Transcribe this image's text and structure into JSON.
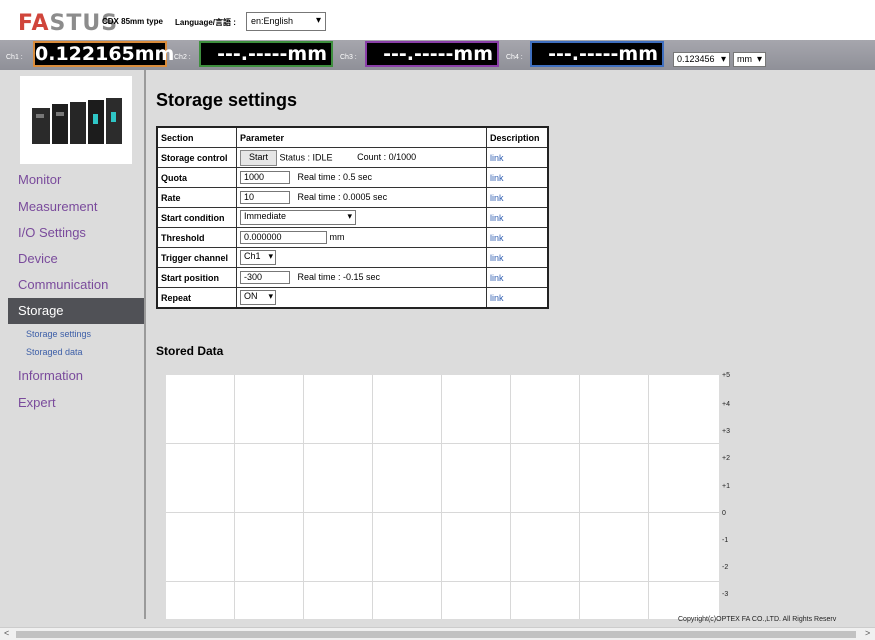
{
  "header": {
    "logo_fa": "FA",
    "logo_rest": "STUS",
    "product_type": "CDX 85mm type",
    "language_label": "Language/言語 :",
    "language_value": "en:English"
  },
  "channels": [
    {
      "label": "Ch1 :",
      "value": "0.122165mm",
      "border": "#d98c3c"
    },
    {
      "label": "Ch2 :",
      "value": "---.-----mm",
      "border": "#3e8f3e"
    },
    {
      "label": "Ch3 :",
      "value": "---.-----mm",
      "border": "#8a3fa8"
    },
    {
      "label": "Ch4 :",
      "value": "---.-----mm",
      "border": "#3f6fbf"
    }
  ],
  "display_format": "0.123456",
  "unit": "mm",
  "sidebar": {
    "items": [
      {
        "label": "Monitor"
      },
      {
        "label": "Measurement"
      },
      {
        "label": "I/O Settings"
      },
      {
        "label": "Device"
      },
      {
        "label": "Communication"
      },
      {
        "label": "Storage"
      },
      {
        "label": "Information"
      },
      {
        "label": "Expert"
      }
    ],
    "sub_items": [
      {
        "label": "Storage settings"
      },
      {
        "label": "Storaged data"
      }
    ]
  },
  "main": {
    "title": "Storage settings",
    "table": {
      "headers": [
        "Section",
        "Parameter",
        "Description"
      ],
      "storage_control": {
        "label": "Storage control",
        "button": "Start",
        "status": "Status : IDLE",
        "count": "Count : 0/1000",
        "link": "link"
      },
      "quota": {
        "label": "Quota",
        "value": "1000",
        "note": "Real time : 0.5 sec",
        "link": "link"
      },
      "rate": {
        "label": "Rate",
        "value": "10",
        "note": "Real time : 0.0005 sec",
        "link": "link"
      },
      "start_condition": {
        "label": "Start condition",
        "value": "Immediate",
        "link": "link"
      },
      "threshold": {
        "label": "Threshold",
        "value": "0.000000",
        "unit": "mm",
        "link": "link"
      },
      "trigger_channel": {
        "label": "Trigger channel",
        "value": "Ch1",
        "link": "link"
      },
      "start_position": {
        "label": "Start position",
        "value": "-300",
        "note": "Real time : -0.15 sec",
        "link": "link"
      },
      "repeat": {
        "label": "Repeat",
        "value": "ON",
        "link": "link"
      }
    },
    "stored_data_title": "Stored Data",
    "y_ticks": [
      "+5",
      "+4",
      "+3",
      "+2",
      "+1",
      "0",
      "-1",
      "-2",
      "-3"
    ]
  },
  "footer": {
    "copyright": "Copyright(c)OPTEX FA CO.,LTD. All Rights Reserv"
  }
}
